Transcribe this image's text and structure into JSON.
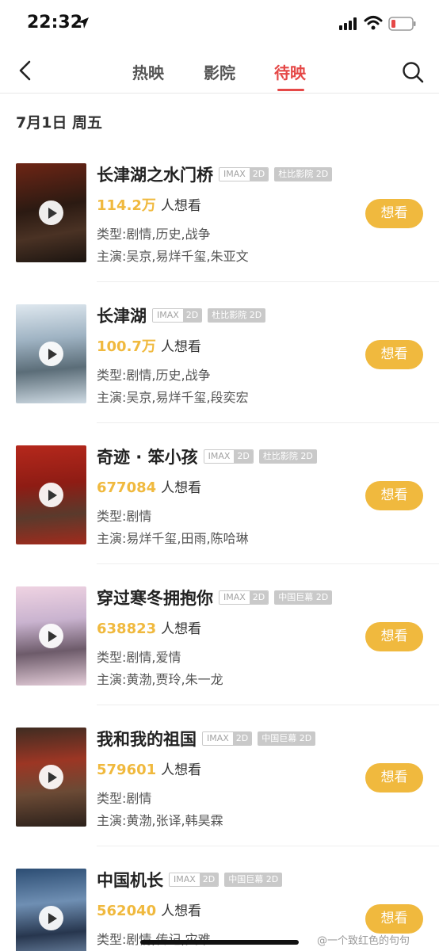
{
  "status_bar": {
    "time": "22:32"
  },
  "nav": {
    "tabs": [
      {
        "label": "热映"
      },
      {
        "label": "影院"
      },
      {
        "label": "待映"
      }
    ]
  },
  "date_header": "7月1日 周五",
  "badges": {
    "imax": "IMAX",
    "two_d": "2D"
  },
  "movies": [
    {
      "title": "长津湖之水门桥",
      "format": "杜比影院 2D",
      "want_count": "114.2万",
      "want_label": "人想看",
      "genre": "类型:剧情,历史,战争",
      "cast": "主演:吴京,易烊千玺,朱亚文",
      "button": "想看"
    },
    {
      "title": "长津湖",
      "format": "杜比影院 2D",
      "want_count": "100.7万",
      "want_label": "人想看",
      "genre": "类型:剧情,历史,战争",
      "cast": "主演:吴京,易烊千玺,段奕宏",
      "button": "想看"
    },
    {
      "title": "奇迹 · 笨小孩",
      "format": "杜比影院 2D",
      "want_count": "677084",
      "want_label": "人想看",
      "genre": "类型:剧情",
      "cast": "主演:易烊千玺,田雨,陈哈琳",
      "button": "想看"
    },
    {
      "title": "穿过寒冬拥抱你",
      "format": "中国巨幕 2D",
      "want_count": "638823",
      "want_label": "人想看",
      "genre": "类型:剧情,爱情",
      "cast": "主演:黄渤,贾玲,朱一龙",
      "button": "想看"
    },
    {
      "title": "我和我的祖国",
      "format": "中国巨幕 2D",
      "want_count": "579601",
      "want_label": "人想看",
      "genre": "类型:剧情",
      "cast": "主演:黄渤,张译,韩昊霖",
      "button": "想看"
    },
    {
      "title": "中国机长",
      "format": "中国巨幕 2D",
      "want_count": "562040",
      "want_label": "人想看",
      "genre": "类型:剧情,传记,灾难",
      "cast": "",
      "button": "想看"
    }
  ],
  "watermark": "@一个致红色的句句",
  "colors": {
    "accent_red": "#e54847",
    "want_yellow": "#f0b93e",
    "badge_gray": "#c9c9c9"
  }
}
